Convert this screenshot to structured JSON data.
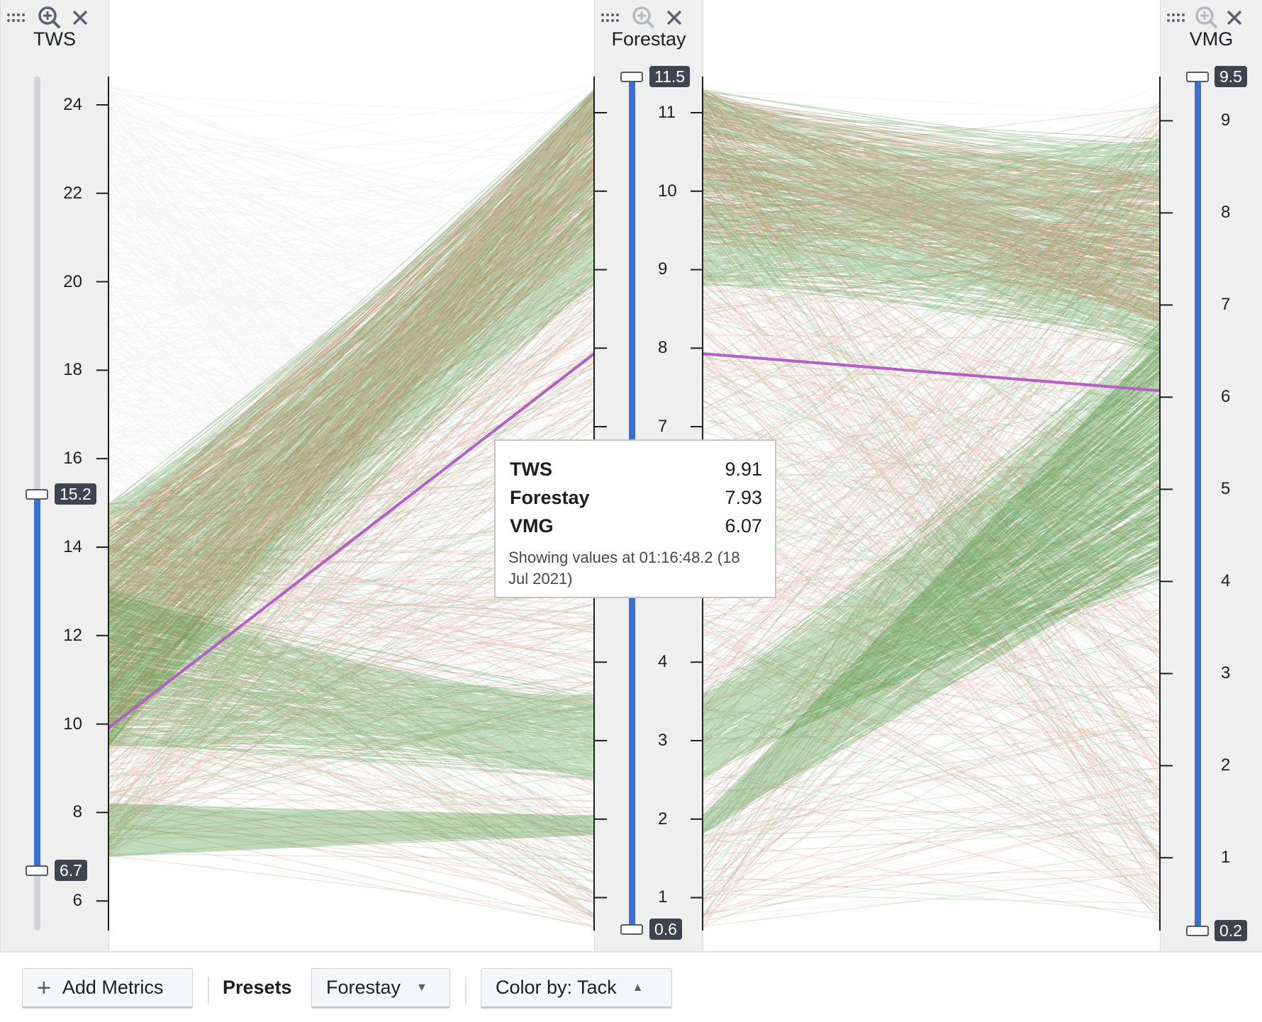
{
  "axes": [
    {
      "title": "TWS",
      "range": [
        5.33,
        24.64
      ],
      "ticks": [
        6,
        8,
        10,
        12,
        14,
        16,
        18,
        20,
        22,
        24
      ],
      "filter": {
        "min": 6.7,
        "max": 15.2
      },
      "badge_max": "15.2",
      "badge_min": "6.7"
    },
    {
      "title": "Forestay",
      "range": [
        0.58,
        11.46
      ],
      "ticks": [
        1,
        2,
        3,
        4,
        5,
        6,
        7,
        8,
        9,
        10,
        11
      ],
      "filter": {
        "min": 0.6,
        "max": 11.5
      },
      "badge_max": "11.5",
      "badge_min": "0.6"
    },
    {
      "title": "VMG",
      "range": [
        0.21,
        9.48
      ],
      "ticks": [
        1,
        2,
        3,
        4,
        5,
        6,
        7,
        8,
        9
      ],
      "filter": {
        "min": 0.2,
        "max": 9.5
      },
      "badge_max": "9.5",
      "badge_min": "0.2"
    }
  ],
  "icons": {
    "drag": "drag-handle-icon",
    "zoom": "zoom-in-icon",
    "close": "close-icon"
  },
  "colors": {
    "port": "#3a8a2a",
    "starboard": "#e0604e",
    "filtered_out": "#b8b8b8",
    "highlight": "#b35fc4",
    "slider": "#3b6fd1"
  },
  "highlight": {
    "TWS": 9.91,
    "Forestay": 7.93,
    "VMG": 6.07
  },
  "tooltip": {
    "rows": [
      {
        "label": "TWS",
        "value": "9.91"
      },
      {
        "label": "Forestay",
        "value": "7.93"
      },
      {
        "label": "VMG",
        "value": "6.07"
      }
    ],
    "footer": "Showing values at 01:16:48.2 (18 Jul 2021)"
  },
  "toolbar": {
    "add_metrics": "Add Metrics",
    "presets_label": "Presets",
    "preset_value": "Forestay",
    "color_by": "Color by: Tack"
  }
}
